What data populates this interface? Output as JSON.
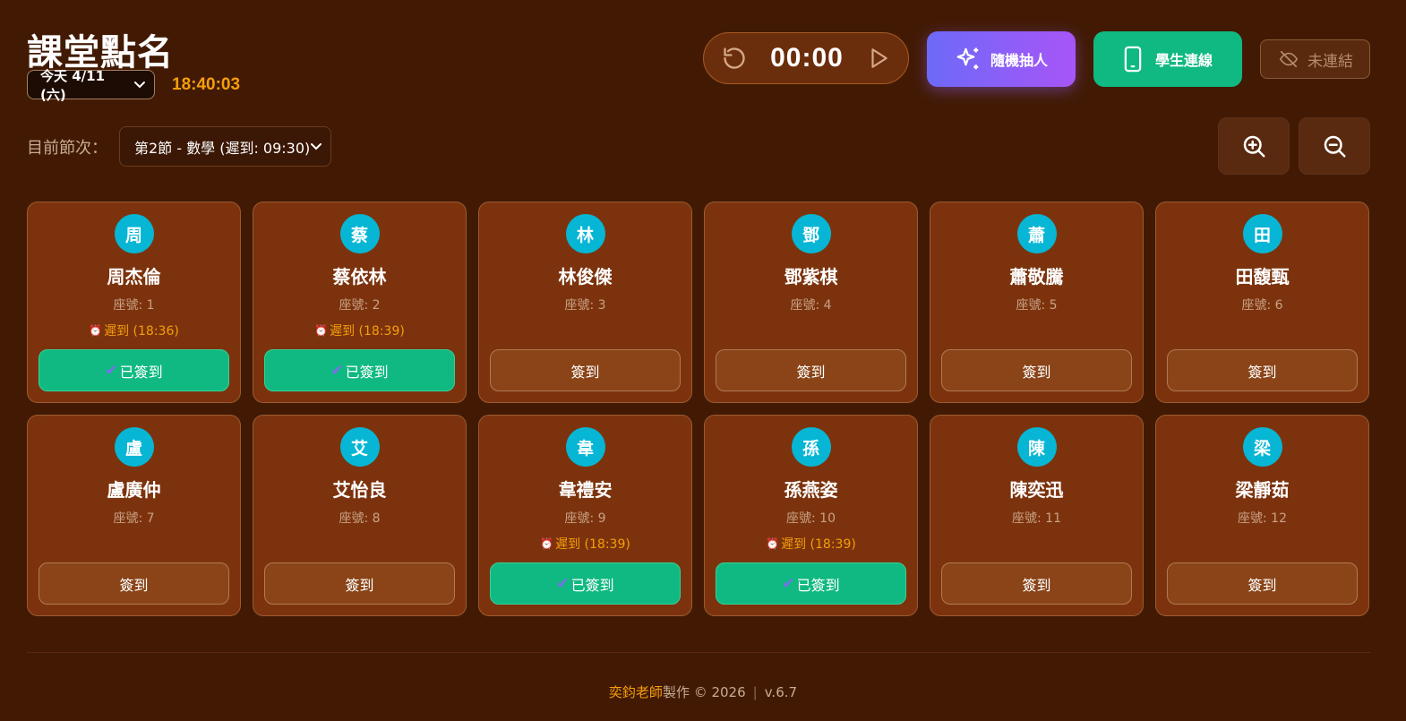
{
  "header": {
    "title": "課堂點名",
    "date_select": "今天 4/11 (六)",
    "clock": "18:40:03"
  },
  "timer": {
    "time": "00:00"
  },
  "actions": {
    "random_label": "隨機抽人",
    "connect_label": "學生連線",
    "status_label": "未連結"
  },
  "period": {
    "label": "目前節次：",
    "selected": "第2節 - 數學 (遲到: 09:30)"
  },
  "students": [
    {
      "initial": "周",
      "name": "周杰倫",
      "seat": "座號: 1",
      "late": "遲到 (18:36)",
      "button": "已簽到"
    },
    {
      "initial": "蔡",
      "name": "蔡依林",
      "seat": "座號: 2",
      "late": "遲到 (18:39)",
      "button": "已簽到"
    },
    {
      "initial": "林",
      "name": "林俊傑",
      "seat": "座號: 3",
      "late": "",
      "button": "簽到"
    },
    {
      "initial": "鄧",
      "name": "鄧紫棋",
      "seat": "座號: 4",
      "late": "",
      "button": "簽到"
    },
    {
      "initial": "蕭",
      "name": "蕭敬騰",
      "seat": "座號: 5",
      "late": "",
      "button": "簽到"
    },
    {
      "initial": "田",
      "name": "田馥甄",
      "seat": "座號: 6",
      "late": "",
      "button": "簽到"
    },
    {
      "initial": "盧",
      "name": "盧廣仲",
      "seat": "座號: 7",
      "late": "",
      "button": "簽到"
    },
    {
      "initial": "艾",
      "name": "艾怡良",
      "seat": "座號: 8",
      "late": "",
      "button": "簽到"
    },
    {
      "initial": "韋",
      "name": "韋禮安",
      "seat": "座號: 9",
      "late": "遲到 (18:39)",
      "button": "已簽到"
    },
    {
      "initial": "孫",
      "name": "孫燕姿",
      "seat": "座號: 10",
      "late": "遲到 (18:39)",
      "button": "已簽到"
    },
    {
      "initial": "陳",
      "name": "陳奕迅",
      "seat": "座號: 11",
      "late": "",
      "button": "簽到"
    },
    {
      "initial": "梁",
      "name": "梁靜茹",
      "seat": "座號: 12",
      "late": "",
      "button": "簽到"
    }
  ],
  "footer": {
    "author": "奕鈞老師",
    "text": "製作 © 2026",
    "version": "v.6.7"
  }
}
